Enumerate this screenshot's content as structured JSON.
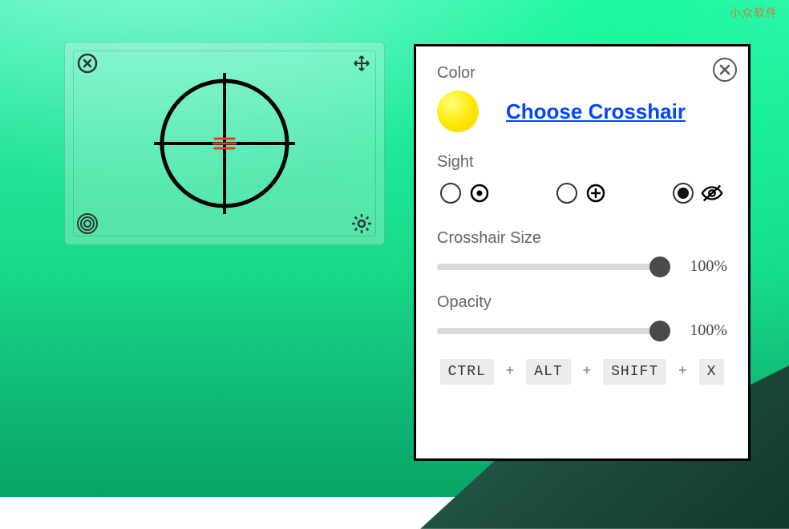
{
  "watermark": "小众软件",
  "panel": {
    "color_label": "Color",
    "choose_link": "Choose Crosshair",
    "swatch_color": "#ffe600",
    "sight_label": "Sight",
    "sight_options": [
      {
        "id": "dot",
        "checked": false
      },
      {
        "id": "cross",
        "checked": false
      },
      {
        "id": "off",
        "checked": true
      }
    ],
    "size_label": "Crosshair Size",
    "size_value": 100,
    "size_display": "100%",
    "opacity_label": "Opacity",
    "opacity_value": 100,
    "opacity_display": "100%",
    "hotkey": {
      "k1": "CTRL",
      "k2": "ALT",
      "k3": "SHIFT",
      "k4": "X",
      "sep": "+"
    }
  }
}
